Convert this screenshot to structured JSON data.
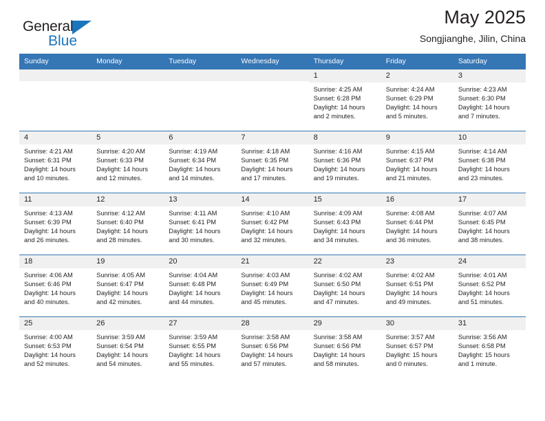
{
  "brand": {
    "name_top": "General",
    "name_bottom": "Blue",
    "accent_color": "#1b75bb"
  },
  "header": {
    "title": "May 2025",
    "subtitle": "Songjianghe, Jilin, China"
  },
  "theme": {
    "header_bg": "#3576b5",
    "daynum_bg": "#f0f0f0",
    "text": "#231f20"
  },
  "calendar": {
    "weekday_headers": [
      "Sunday",
      "Monday",
      "Tuesday",
      "Wednesday",
      "Thursday",
      "Friday",
      "Saturday"
    ],
    "labels": {
      "sunrise": "Sunrise:",
      "sunset": "Sunset:",
      "daylight": "Daylight:"
    },
    "weeks": [
      [
        {
          "day": "",
          "empty": true
        },
        {
          "day": "",
          "empty": true
        },
        {
          "day": "",
          "empty": true
        },
        {
          "day": "",
          "empty": true
        },
        {
          "day": "1",
          "sunrise": "Sunrise: 4:25 AM",
          "sunset": "Sunset: 6:28 PM",
          "daylight_l1": "Daylight: 14 hours",
          "daylight_l2": "and 2 minutes."
        },
        {
          "day": "2",
          "sunrise": "Sunrise: 4:24 AM",
          "sunset": "Sunset: 6:29 PM",
          "daylight_l1": "Daylight: 14 hours",
          "daylight_l2": "and 5 minutes."
        },
        {
          "day": "3",
          "sunrise": "Sunrise: 4:23 AM",
          "sunset": "Sunset: 6:30 PM",
          "daylight_l1": "Daylight: 14 hours",
          "daylight_l2": "and 7 minutes."
        }
      ],
      [
        {
          "day": "4",
          "sunrise": "Sunrise: 4:21 AM",
          "sunset": "Sunset: 6:31 PM",
          "daylight_l1": "Daylight: 14 hours",
          "daylight_l2": "and 10 minutes."
        },
        {
          "day": "5",
          "sunrise": "Sunrise: 4:20 AM",
          "sunset": "Sunset: 6:33 PM",
          "daylight_l1": "Daylight: 14 hours",
          "daylight_l2": "and 12 minutes."
        },
        {
          "day": "6",
          "sunrise": "Sunrise: 4:19 AM",
          "sunset": "Sunset: 6:34 PM",
          "daylight_l1": "Daylight: 14 hours",
          "daylight_l2": "and 14 minutes."
        },
        {
          "day": "7",
          "sunrise": "Sunrise: 4:18 AM",
          "sunset": "Sunset: 6:35 PM",
          "daylight_l1": "Daylight: 14 hours",
          "daylight_l2": "and 17 minutes."
        },
        {
          "day": "8",
          "sunrise": "Sunrise: 4:16 AM",
          "sunset": "Sunset: 6:36 PM",
          "daylight_l1": "Daylight: 14 hours",
          "daylight_l2": "and 19 minutes."
        },
        {
          "day": "9",
          "sunrise": "Sunrise: 4:15 AM",
          "sunset": "Sunset: 6:37 PM",
          "daylight_l1": "Daylight: 14 hours",
          "daylight_l2": "and 21 minutes."
        },
        {
          "day": "10",
          "sunrise": "Sunrise: 4:14 AM",
          "sunset": "Sunset: 6:38 PM",
          "daylight_l1": "Daylight: 14 hours",
          "daylight_l2": "and 23 minutes."
        }
      ],
      [
        {
          "day": "11",
          "sunrise": "Sunrise: 4:13 AM",
          "sunset": "Sunset: 6:39 PM",
          "daylight_l1": "Daylight: 14 hours",
          "daylight_l2": "and 26 minutes."
        },
        {
          "day": "12",
          "sunrise": "Sunrise: 4:12 AM",
          "sunset": "Sunset: 6:40 PM",
          "daylight_l1": "Daylight: 14 hours",
          "daylight_l2": "and 28 minutes."
        },
        {
          "day": "13",
          "sunrise": "Sunrise: 4:11 AM",
          "sunset": "Sunset: 6:41 PM",
          "daylight_l1": "Daylight: 14 hours",
          "daylight_l2": "and 30 minutes."
        },
        {
          "day": "14",
          "sunrise": "Sunrise: 4:10 AM",
          "sunset": "Sunset: 6:42 PM",
          "daylight_l1": "Daylight: 14 hours",
          "daylight_l2": "and 32 minutes."
        },
        {
          "day": "15",
          "sunrise": "Sunrise: 4:09 AM",
          "sunset": "Sunset: 6:43 PM",
          "daylight_l1": "Daylight: 14 hours",
          "daylight_l2": "and 34 minutes."
        },
        {
          "day": "16",
          "sunrise": "Sunrise: 4:08 AM",
          "sunset": "Sunset: 6:44 PM",
          "daylight_l1": "Daylight: 14 hours",
          "daylight_l2": "and 36 minutes."
        },
        {
          "day": "17",
          "sunrise": "Sunrise: 4:07 AM",
          "sunset": "Sunset: 6:45 PM",
          "daylight_l1": "Daylight: 14 hours",
          "daylight_l2": "and 38 minutes."
        }
      ],
      [
        {
          "day": "18",
          "sunrise": "Sunrise: 4:06 AM",
          "sunset": "Sunset: 6:46 PM",
          "daylight_l1": "Daylight: 14 hours",
          "daylight_l2": "and 40 minutes."
        },
        {
          "day": "19",
          "sunrise": "Sunrise: 4:05 AM",
          "sunset": "Sunset: 6:47 PM",
          "daylight_l1": "Daylight: 14 hours",
          "daylight_l2": "and 42 minutes."
        },
        {
          "day": "20",
          "sunrise": "Sunrise: 4:04 AM",
          "sunset": "Sunset: 6:48 PM",
          "daylight_l1": "Daylight: 14 hours",
          "daylight_l2": "and 44 minutes."
        },
        {
          "day": "21",
          "sunrise": "Sunrise: 4:03 AM",
          "sunset": "Sunset: 6:49 PM",
          "daylight_l1": "Daylight: 14 hours",
          "daylight_l2": "and 45 minutes."
        },
        {
          "day": "22",
          "sunrise": "Sunrise: 4:02 AM",
          "sunset": "Sunset: 6:50 PM",
          "daylight_l1": "Daylight: 14 hours",
          "daylight_l2": "and 47 minutes."
        },
        {
          "day": "23",
          "sunrise": "Sunrise: 4:02 AM",
          "sunset": "Sunset: 6:51 PM",
          "daylight_l1": "Daylight: 14 hours",
          "daylight_l2": "and 49 minutes."
        },
        {
          "day": "24",
          "sunrise": "Sunrise: 4:01 AM",
          "sunset": "Sunset: 6:52 PM",
          "daylight_l1": "Daylight: 14 hours",
          "daylight_l2": "and 51 minutes."
        }
      ],
      [
        {
          "day": "25",
          "sunrise": "Sunrise: 4:00 AM",
          "sunset": "Sunset: 6:53 PM",
          "daylight_l1": "Daylight: 14 hours",
          "daylight_l2": "and 52 minutes."
        },
        {
          "day": "26",
          "sunrise": "Sunrise: 3:59 AM",
          "sunset": "Sunset: 6:54 PM",
          "daylight_l1": "Daylight: 14 hours",
          "daylight_l2": "and 54 minutes."
        },
        {
          "day": "27",
          "sunrise": "Sunrise: 3:59 AM",
          "sunset": "Sunset: 6:55 PM",
          "daylight_l1": "Daylight: 14 hours",
          "daylight_l2": "and 55 minutes."
        },
        {
          "day": "28",
          "sunrise": "Sunrise: 3:58 AM",
          "sunset": "Sunset: 6:56 PM",
          "daylight_l1": "Daylight: 14 hours",
          "daylight_l2": "and 57 minutes."
        },
        {
          "day": "29",
          "sunrise": "Sunrise: 3:58 AM",
          "sunset": "Sunset: 6:56 PM",
          "daylight_l1": "Daylight: 14 hours",
          "daylight_l2": "and 58 minutes."
        },
        {
          "day": "30",
          "sunrise": "Sunrise: 3:57 AM",
          "sunset": "Sunset: 6:57 PM",
          "daylight_l1": "Daylight: 15 hours",
          "daylight_l2": "and 0 minutes."
        },
        {
          "day": "31",
          "sunrise": "Sunrise: 3:56 AM",
          "sunset": "Sunset: 6:58 PM",
          "daylight_l1": "Daylight: 15 hours",
          "daylight_l2": "and 1 minute."
        }
      ]
    ]
  }
}
